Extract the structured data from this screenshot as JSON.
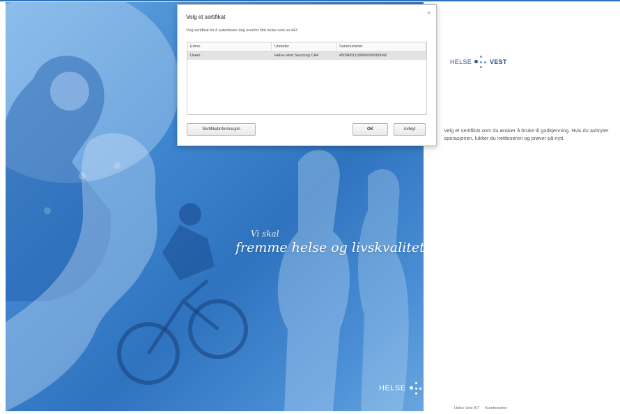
{
  "dialog": {
    "title": "Velg et sertifikat",
    "close_glyph": "×",
    "description": "Velg sertifikat for å autentisere deg ovenfor idm.helse-vest.no:443",
    "columns": [
      "Emne",
      "Utsteder",
      "Serienummer"
    ],
    "rows": [
      [
        "Users",
        "Helse-Vest Sourcing CA4",
        "4509F81158000000000042"
      ]
    ],
    "buttons": {
      "info": "Sertifikatinformasjon",
      "ok": "OK",
      "cancel": "Avbryt"
    }
  },
  "hero": {
    "slogan_line1": "Vi skal",
    "slogan_line2": "fremme helse og livskvalitet",
    "logo_text": "HELSE"
  },
  "brand": {
    "helse": "HELSE",
    "vest": "VEST"
  },
  "info_text": "Velg et sertifikat som du ønsker å bruke til godkjenning. Hvis du avbryter operasjonen, lukker du nettleseren og prøver på nytt.",
  "footer": {
    "link1": "Helse Vest IKT",
    "link2": "Kundesenter"
  },
  "colors": {
    "hero_blue": "#3f86cf",
    "brand_blue": "#2b4d86"
  }
}
